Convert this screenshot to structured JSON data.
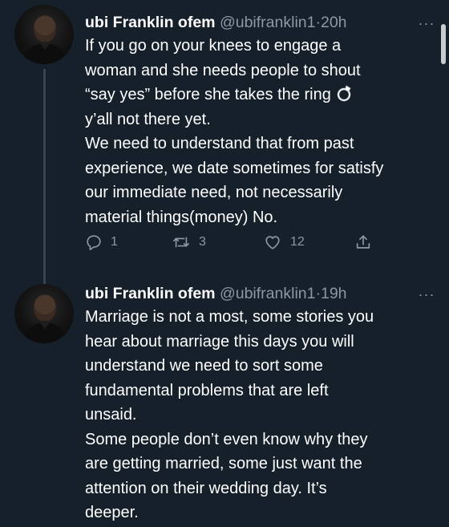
{
  "tweets": [
    {
      "author": {
        "name": "ubi Franklin ofem",
        "handle": "@ubifranklin1",
        "separator": "·",
        "time": "20h"
      },
      "more": "···",
      "lines": [
        "If you go on your knees to engage a",
        "woman and she needs people to shout",
        "“say yes” before she takes the ring",
        "y’all not there yet.",
        "We need to understand that from past",
        "experience, we date sometimes for satisfy",
        "our immediate need, not necessarily",
        "material things(money) No."
      ],
      "ring_emoji": "💍",
      "actions": {
        "reply_count": "1",
        "retweet_count": "3",
        "like_count": "12"
      }
    },
    {
      "author": {
        "name": "ubi Franklin ofem",
        "handle": "@ubifranklin1",
        "separator": "·",
        "time": "19h"
      },
      "more": "···",
      "lines": [
        "Marriage is not a most, some stories you",
        "hear about marriage this days you will",
        "understand we need to sort some",
        "fundamental problems that are left",
        "unsaid.",
        "Some people don’t even know why they",
        "are getting married, some just want the",
        "attention on their wedding day. It’s",
        "deeper."
      ]
    }
  ],
  "colors": {
    "background": "#15202b",
    "text": "#ffffff",
    "secondary": "#8b98a5",
    "thread_line": "#38444d"
  },
  "icons": [
    "reply-icon",
    "retweet-icon",
    "like-icon",
    "share-icon",
    "more-icon",
    "ring-icon"
  ]
}
